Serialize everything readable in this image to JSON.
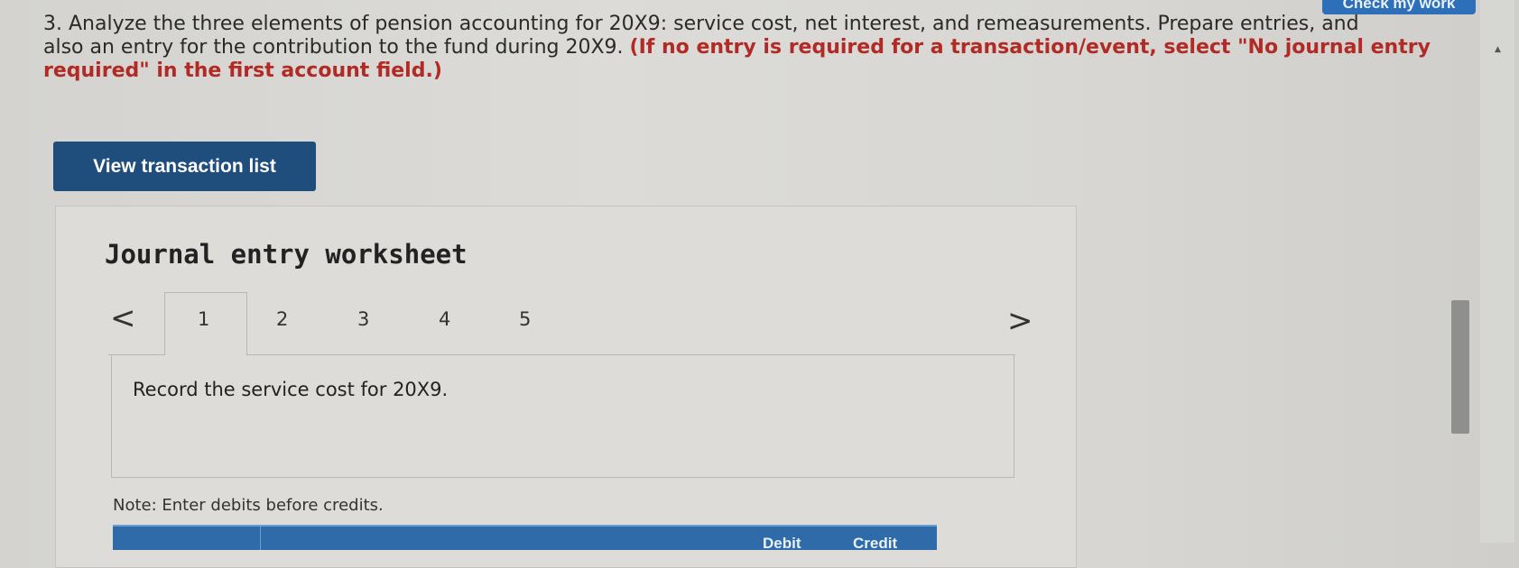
{
  "header": {
    "check_button_label": "Check my work"
  },
  "question": {
    "line1": "3. Analyze the three elements of pension accounting for 20X9: service cost, net interest, and remeasurements. Prepare entries, and",
    "line2_normal": "also an entry for the contribution to the fund during 20X9. ",
    "line2_red": "(If no entry is required for a transaction/event, select \"No journal entry",
    "line3_red": "required\" in the first account field.)"
  },
  "view_transaction_button": "View transaction list",
  "worksheet": {
    "title": "Journal entry worksheet",
    "prev_icon": "<",
    "next_icon": ">",
    "tabs": [
      "1",
      "2",
      "3",
      "4",
      "5"
    ],
    "active_tab": "1",
    "instruction": "Record the service cost for 20X9.",
    "note": "Note: Enter debits before credits.",
    "table_headers": {
      "debit": "Debit",
      "credit": "Credit"
    }
  },
  "colors": {
    "accent": "#1f4e7d",
    "required_text": "#b22a25",
    "table_header": "#2e6ba8"
  }
}
